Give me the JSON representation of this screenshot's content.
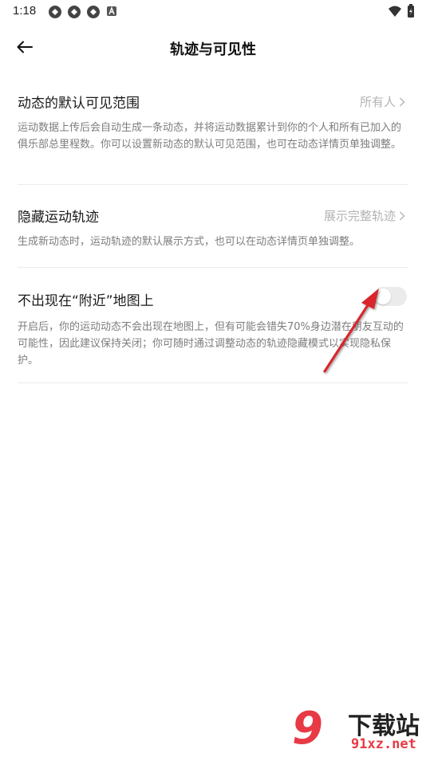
{
  "status_bar": {
    "time": "1:18",
    "notification_icons": [
      "app-icon",
      "app-icon",
      "app-icon",
      "a-badge-icon"
    ],
    "right_icons": [
      "wifi-icon",
      "battery-charging-icon"
    ]
  },
  "header": {
    "title": "轨迹与可见性",
    "back_icon": "arrow-left-icon"
  },
  "settings": [
    {
      "title": "动态的默认可见范围",
      "value": "所有人",
      "description": "运动数据上传后会自动生成一条动态，并将运动数据累计到你的个人和所有已加入的俱乐部总里程数。你可以设置新动态的默认可见范围，也可在动态详情页单独调整。"
    },
    {
      "title": "隐藏运动轨迹",
      "value": "展示完整轨迹",
      "description": "生成新动态时，运动轨迹的默认展示方式，也可以在动态详情页单独调整。"
    },
    {
      "title": "不出现在“附近”地图上",
      "toggle_on": false,
      "description": "开启后，你的运动动态不会出现在地图上，但有可能会错失70%身边潜在朋友互动的可能性，因此建议保持关闭；你可随时通过调整动态的轨迹隐藏模式以实现隐私保护。"
    }
  ],
  "colors": {
    "annotation_arrow": "#d9262c",
    "watermark_red": "#e73a45",
    "toggle_off": "#ebebeb"
  },
  "watermark": {
    "number": "9",
    "brand": "下载站",
    "url": "91xz.net"
  }
}
